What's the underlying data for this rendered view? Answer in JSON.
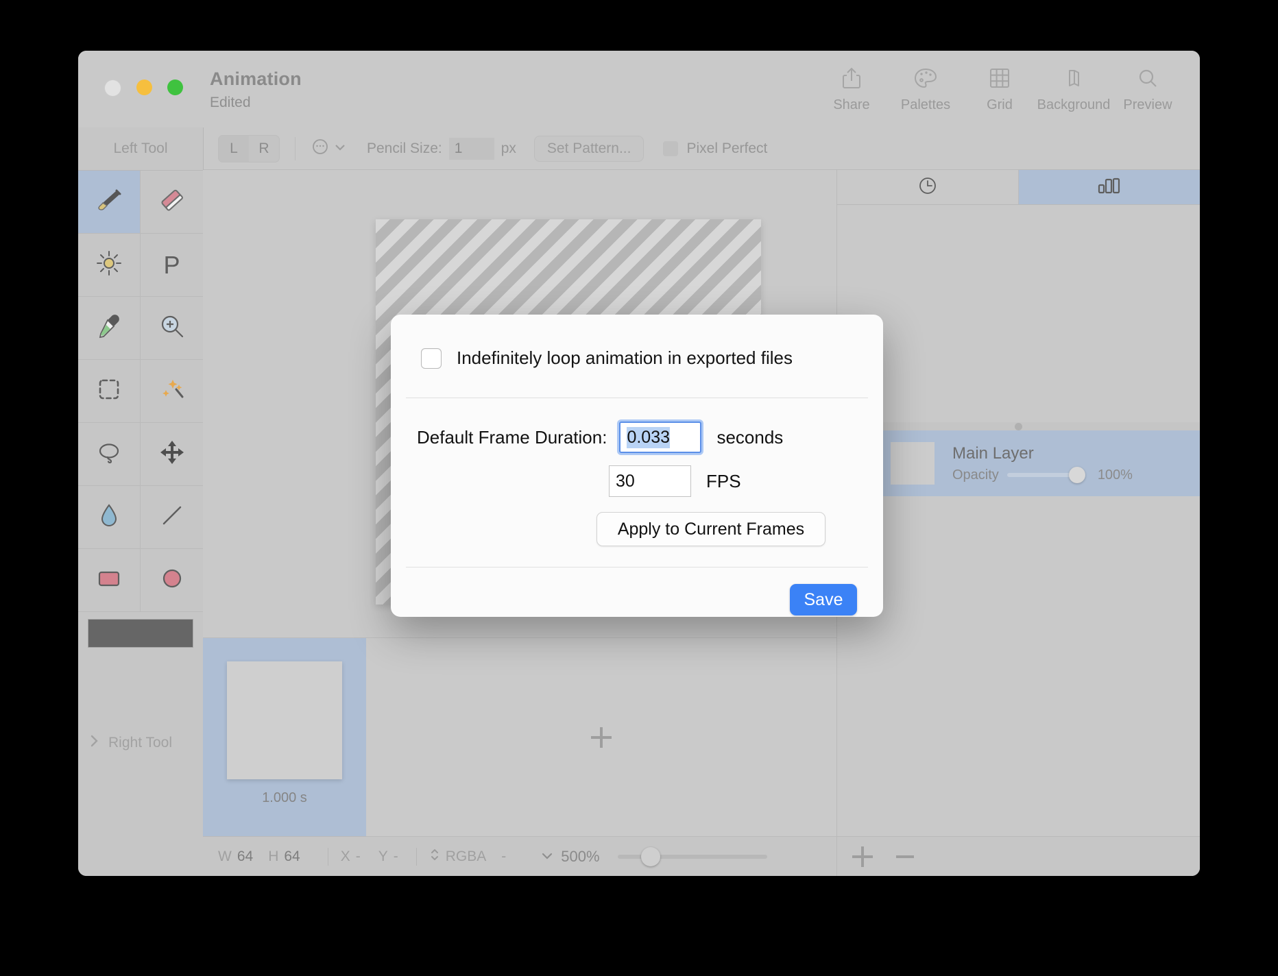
{
  "window": {
    "title": "Animation",
    "subtitle": "Edited",
    "traffic_lights": [
      "close",
      "minimize",
      "maximize"
    ]
  },
  "toolbar": {
    "items": [
      {
        "icon": "share-icon",
        "label": "Share"
      },
      {
        "icon": "palette-icon",
        "label": "Palettes"
      },
      {
        "icon": "grid-icon",
        "label": "Grid"
      },
      {
        "icon": "layers-stack-icon",
        "label": "Background"
      },
      {
        "icon": "magnifier-icon",
        "label": "Preview"
      }
    ]
  },
  "options_bar": {
    "segment": {
      "left": "L",
      "right": "R",
      "selected": "L"
    },
    "more_icon": "ellipsis-circle-icon",
    "pencil_size_label": "Pencil Size:",
    "pencil_size_value": "1",
    "pencil_size_unit": "px",
    "set_pattern_label": "Set Pattern...",
    "pixel_perfect_label": "Pixel Perfect",
    "pixel_perfect_checked": false
  },
  "left_panel": {
    "header": "Left Tool",
    "tools": [
      {
        "name": "brush-tool",
        "icon": "paintbrush-icon",
        "selected": true
      },
      {
        "name": "eraser-tool",
        "icon": "eraser-icon",
        "selected": false
      },
      {
        "name": "dither-tool",
        "icon": "sun-icon",
        "selected": false
      },
      {
        "name": "pattern-tool",
        "icon": "letter-p-icon",
        "selected": false
      },
      {
        "name": "eyedropper-tool",
        "icon": "eyedropper-icon",
        "selected": false
      },
      {
        "name": "zoom-tool",
        "icon": "magnifier-plus-icon",
        "selected": false
      },
      {
        "name": "rect-select-tool",
        "icon": "dashed-rectangle-icon",
        "selected": false
      },
      {
        "name": "magic-wand-tool",
        "icon": "magic-wand-icon",
        "selected": false
      },
      {
        "name": "lasso-tool",
        "icon": "lasso-icon",
        "selected": false
      },
      {
        "name": "move-tool",
        "icon": "move-arrows-icon",
        "selected": false
      },
      {
        "name": "fill-tool",
        "icon": "droplet-icon",
        "selected": false
      },
      {
        "name": "line-tool",
        "icon": "line-icon",
        "selected": false
      },
      {
        "name": "rectangle-tool",
        "icon": "rectangle-icon",
        "selected": false
      },
      {
        "name": "ellipse-tool",
        "icon": "ellipse-icon",
        "selected": false
      }
    ],
    "color_swatch": "#666666",
    "right_tool_label": "Right Tool",
    "right_tool_disclosure": "chevron-right-icon"
  },
  "frames": {
    "items": [
      {
        "duration": "1.000 s",
        "selected": true
      }
    ],
    "add_icon": "plus-icon"
  },
  "status_bar": {
    "width_key": "W",
    "width_value": "64",
    "height_key": "H",
    "height_value": "64",
    "x_key": "X",
    "x_value": "-",
    "y_key": "Y",
    "y_value": "-",
    "color_mode": "RGBA",
    "color_value": "-",
    "color_stepper_icon": "stepper-updown-icon",
    "zoom_chevron_icon": "chevron-down-icon",
    "zoom_value": "500%",
    "zoom_slider_percent": 20
  },
  "right_panel": {
    "tabs": [
      {
        "name": "history-tab",
        "icon": "clock-icon",
        "selected": false
      },
      {
        "name": "layers-tab",
        "icon": "bars-icon",
        "selected": true
      }
    ],
    "layer": {
      "visible": true,
      "check_glyph": "✓",
      "name": "Main Layer",
      "opacity_label": "Opacity",
      "opacity_value": "100%",
      "opacity_percent": 100
    },
    "footer": {
      "add_icon": "plus-icon",
      "remove_icon": "minus-icon"
    }
  },
  "dialog": {
    "loop_checkbox_label": "Indefinitely loop animation in exported files",
    "loop_checked": false,
    "frame_duration_label": "Default Frame Duration:",
    "frame_duration_value": "0.033",
    "frame_duration_unit": "seconds",
    "fps_value": "30",
    "fps_unit": "FPS",
    "apply_button_label": "Apply to Current Frames",
    "save_button_label": "Save",
    "accent_color": "#3b82f6",
    "selection_color": "#b9d3f5"
  }
}
